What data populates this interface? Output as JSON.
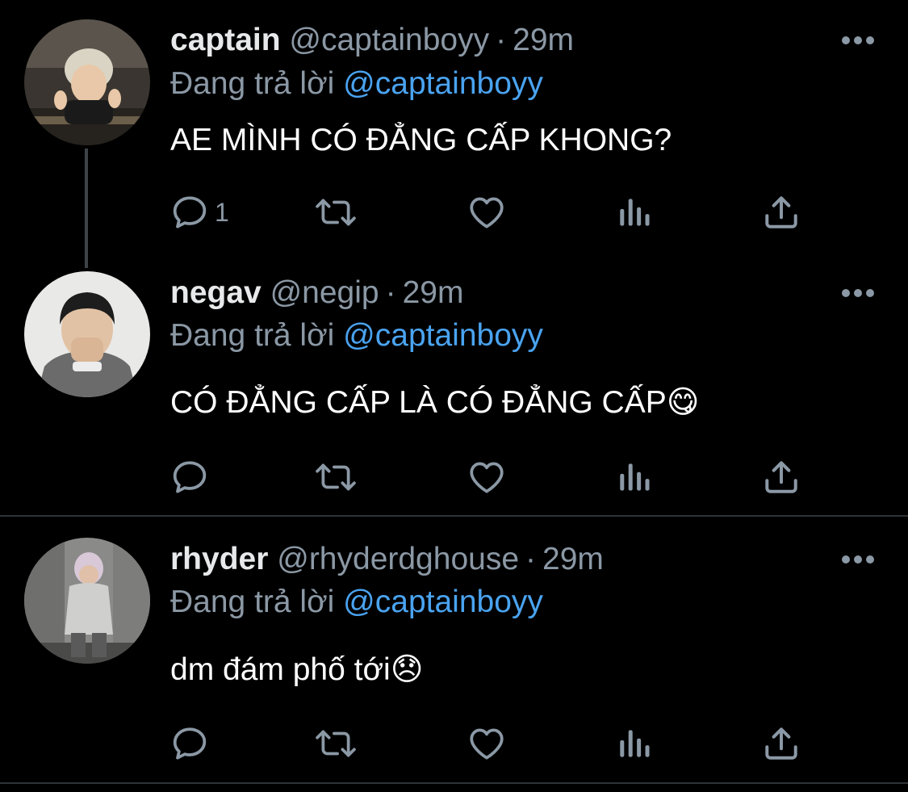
{
  "colors": {
    "background": "#000000",
    "primary_text": "#e7e9ea",
    "secondary_text": "#8b98a5",
    "mention": "#4aa3f0",
    "divider": "#2f3336"
  },
  "icons": {
    "more": "more-horizontal-icon",
    "reply": "reply-bubble-icon",
    "retweet": "retweet-icon",
    "like": "heart-icon",
    "views": "bar-chart-icon",
    "share": "share-upload-icon"
  },
  "tweets": [
    {
      "name": "captain",
      "handle": "@captainboyy",
      "separator": "·",
      "time": "29m",
      "reply_prefix": "Đang trả lời",
      "reply_to": "@captainboyy",
      "text": "AE MÌNH CÓ ĐẲNG CẤP KHONG?",
      "reply_count": "1"
    },
    {
      "name": "negav",
      "handle": "@negip",
      "separator": "·",
      "time": "29m",
      "reply_prefix": "Đang trả lời",
      "reply_to": "@captainboyy",
      "text": "CÓ ĐẲNG CẤP LÀ CÓ ĐẲNG CẤP",
      "emoji": "😋",
      "reply_count": ""
    },
    {
      "name": "rhyder",
      "handle": "@rhyderdghouse",
      "separator": "·",
      "time": "29m",
      "reply_prefix": "Đang trả lời",
      "reply_to": "@captainboyy",
      "text": "dm đám phố tới",
      "emoji": "😞",
      "reply_count": ""
    }
  ]
}
